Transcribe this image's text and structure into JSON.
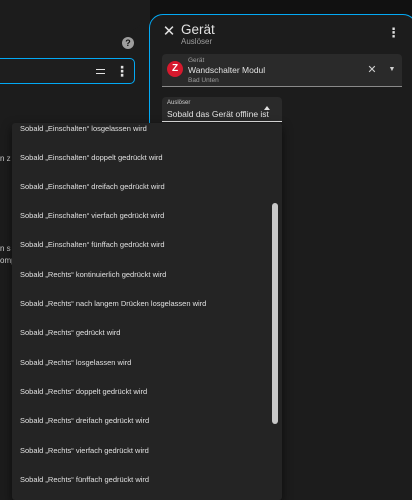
{
  "background": {
    "help_icon": "?",
    "fragment_1": "n z",
    "fragment_2": "n s",
    "fragment_3": "omp"
  },
  "dialog": {
    "title": "Gerät",
    "subtitle": "Auslöser",
    "close_icon": "close-icon",
    "menu_icon": "dots-vertical-icon"
  },
  "device": {
    "label": "Gerät",
    "value": "Wandschalter Modul",
    "area": "Bad Unten",
    "icon_letter": "Z"
  },
  "trigger": {
    "label": "Auslöser",
    "value": "Sobald das Gerät offline ist"
  },
  "dropdown": {
    "items": [
      "Sobald „Einschalten“ losgelassen wird",
      "Sobald „Einschalten“ doppelt gedrückt wird",
      "Sobald „Einschalten“ dreifach gedrückt wird",
      "Sobald „Einschalten“ vierfach gedrückt wird",
      "Sobald „Einschalten“ fünffach gedrückt wird",
      "Sobald „Rechts“ kontinuierlich gedrückt wird",
      "Sobald „Rechts“ nach langem Drücken losgelassen wird",
      "Sobald „Rechts“ gedrückt wird",
      "Sobald „Rechts“ losgelassen wird",
      "Sobald „Rechts“ doppelt gedrückt wird",
      "Sobald „Rechts“ dreifach gedrückt wird",
      "Sobald „Rechts“ vierfach gedrückt wird",
      "Sobald „Rechts“ fünffach gedrückt wird"
    ]
  },
  "colors": {
    "accent": "#03a9f4",
    "zwave_red": "#d6192d",
    "surface": "#1c1c1c"
  }
}
